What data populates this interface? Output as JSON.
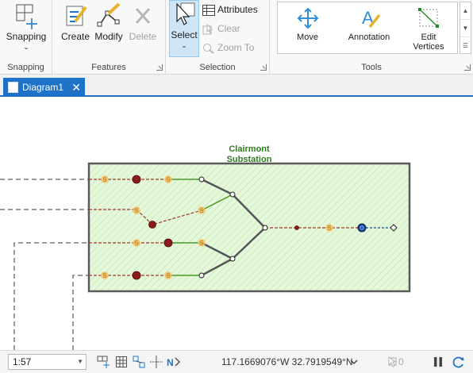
{
  "ribbon": {
    "snapping": {
      "button_label": "Snapping",
      "group_label": "Snapping"
    },
    "features": {
      "create_label": "Create",
      "modify_label": "Modify",
      "delete_label": "Delete",
      "group_label": "Features"
    },
    "selection": {
      "select_label": "Select",
      "attributes_label": "Attributes",
      "clear_label": "Clear",
      "zoom_to_label": "Zoom To",
      "group_label": "Selection"
    },
    "tools": {
      "move_label": "Move",
      "annotation_label": "Annotation",
      "edit_vertices_label_1": "Edit",
      "edit_vertices_label_2": "Vertices",
      "group_label": "Tools"
    }
  },
  "tabs": [
    {
      "label": "Diagram1",
      "close_glyph": "✕",
      "active": true
    }
  ],
  "map": {
    "substation_label_line1": "Clairmont",
    "substation_label_line2": "Substation",
    "feature_symbol": "S",
    "colors": {
      "fill": "#e6f8dc",
      "label": "#2e7d1e",
      "line_green": "#4a9a2a",
      "line_red": "#a33a2a",
      "node_red": "#8b1a1a",
      "node_blue": "#1a4fa0",
      "switch": "#f3c36a"
    }
  },
  "statusbar": {
    "scale_value": "1:57",
    "coordinates": "117.1669076°W 32.7919549°N",
    "selected_count": "0",
    "icons": [
      "snap-icon",
      "grid-icon",
      "constraints-icon",
      "dynamic-icon",
      "north-icon",
      "selection-count-icon",
      "pause-icon",
      "refresh-icon"
    ]
  }
}
